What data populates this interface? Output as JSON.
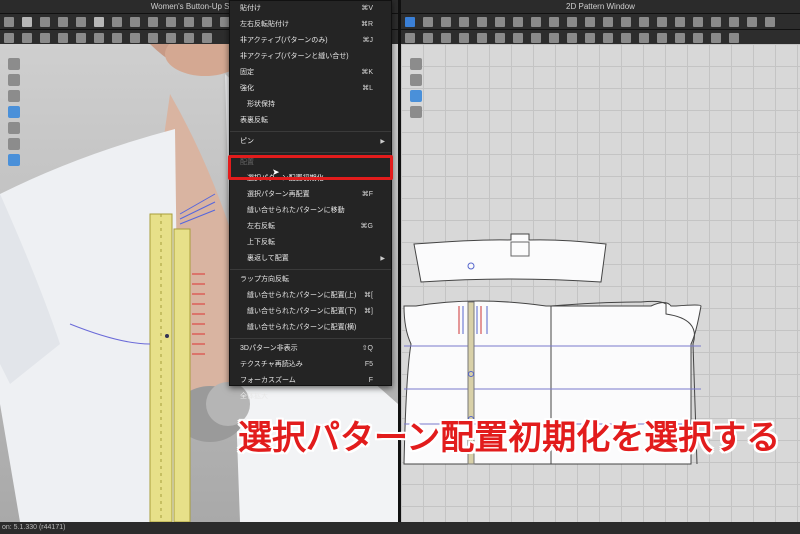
{
  "window3d": {
    "title": "Women's Button-Up Shirt..."
  },
  "window2d": {
    "title": "2D Pattern Window"
  },
  "status": {
    "text": "on: 5.1.330 (r44171)"
  },
  "menu": {
    "items": [
      {
        "label": "貼付け",
        "shortcut": "⌘V"
      },
      {
        "label": "左右反転貼付け",
        "shortcut": "⌘R"
      },
      {
        "label": "非アクティブ(パターンのみ)",
        "shortcut": "⌘J"
      },
      {
        "label": "非アクティブ(パターンと縫い合せ)",
        "shortcut": ""
      },
      {
        "label": "固定",
        "shortcut": "⌘K"
      },
      {
        "label": "強化",
        "shortcut": "⌘L"
      },
      {
        "label": "形状保持",
        "shortcut": "",
        "indent": true
      },
      {
        "label": "表裏反転",
        "shortcut": ""
      },
      {
        "label": "ピン",
        "shortcut": "",
        "submenu": true
      },
      {
        "label": "配置",
        "shortcut": "",
        "disabled": true
      },
      {
        "label": "選択パターン配置初期化",
        "shortcut": "",
        "indent": true,
        "highlight": true
      },
      {
        "label": "選択パターン再配置",
        "shortcut": "⌘F",
        "indent": true
      },
      {
        "label": "縫い合せられたパターンに移動",
        "shortcut": "",
        "indent": true
      },
      {
        "label": "左右反転",
        "shortcut": "⌘G",
        "indent": true
      },
      {
        "label": "上下反転",
        "shortcut": "",
        "indent": true
      },
      {
        "label": "裏返して配置",
        "shortcut": "",
        "indent": true,
        "submenu": true
      },
      {
        "label": "ラップ方向反転",
        "shortcut": ""
      },
      {
        "label": "縫い合せられたパターンに配置(上)",
        "shortcut": "⌘[",
        "indent": true
      },
      {
        "label": "縫い合せられたパターンに配置(下)",
        "shortcut": "⌘]",
        "indent": true
      },
      {
        "label": "縫い合せられたパターンに配置(横)",
        "shortcut": "",
        "indent": true
      },
      {
        "label": "3Dパターン非表示",
        "shortcut": "⇧Q"
      },
      {
        "label": "テクスチャ再読込み",
        "shortcut": "F5"
      },
      {
        "label": "フォーカスズーム",
        "shortcut": "F"
      },
      {
        "label": "全体拡大",
        "shortcut": ""
      }
    ]
  },
  "caption": {
    "text": "選択パターン配置初期化を選択する"
  },
  "colors": {
    "highlight_box": "#e21c1c",
    "caption": "#e21c1c",
    "accent": "#3a7fd6"
  }
}
